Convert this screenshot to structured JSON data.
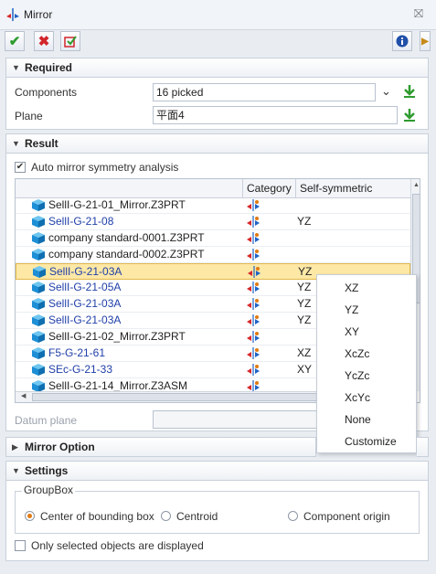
{
  "window": {
    "title": "Mirror"
  },
  "toolbar": {
    "ok_icon": "check-icon",
    "cancel_icon": "x-icon",
    "apply_icon": "apply-icon",
    "info_icon": "info-icon"
  },
  "required": {
    "header": "Required",
    "components_label": "Components",
    "components_value": "16 picked",
    "plane_label": "Plane",
    "plane_value": "平面4"
  },
  "result": {
    "header": "Result",
    "auto_mirror_label": "Auto mirror symmetry analysis",
    "auto_mirror_checked": true,
    "columns": {
      "name": "",
      "category": "Category",
      "self_symmetric": "Self-symmetric"
    },
    "rows": [
      {
        "name": "SellI-G-21-01_Mirror.Z3PRT",
        "blue": false,
        "sym": ""
      },
      {
        "name": "SellI-G-21-08",
        "blue": true,
        "sym": "YZ"
      },
      {
        "name": "company standard-0001.Z3PRT",
        "blue": false,
        "sym": ""
      },
      {
        "name": "company standard-0002.Z3PRT",
        "blue": false,
        "sym": ""
      },
      {
        "name": "SellI-G-21-03A",
        "blue": true,
        "sym": "YZ",
        "selected": true
      },
      {
        "name": "SellI-G-21-05A",
        "blue": true,
        "sym": "YZ"
      },
      {
        "name": "SellI-G-21-03A",
        "blue": true,
        "sym": "YZ"
      },
      {
        "name": "SellI-G-21-03A",
        "blue": true,
        "sym": "YZ"
      },
      {
        "name": "SellI-G-21-02_Mirror.Z3PRT",
        "blue": false,
        "sym": ""
      },
      {
        "name": "F5-G-21-61",
        "blue": true,
        "sym": "XZ"
      },
      {
        "name": "SEc-G-21-33",
        "blue": true,
        "sym": "XY"
      },
      {
        "name": "SellI-G-21-14_Mirror.Z3ASM",
        "blue": false,
        "sym": ""
      }
    ],
    "datum_plane_label": "Datum plane"
  },
  "context_menu": {
    "items": [
      "XZ",
      "YZ",
      "XY",
      "XcZc",
      "YcZc",
      "XcYc",
      "None",
      "Customize"
    ]
  },
  "mirror_option": {
    "header": "Mirror Option"
  },
  "settings": {
    "header": "Settings",
    "groupbox_label": "GroupBox",
    "radio_center": "Center of bounding box",
    "radio_centroid": "Centroid",
    "radio_origin": "Component origin",
    "only_selected_label": "Only selected objects are displayed"
  }
}
